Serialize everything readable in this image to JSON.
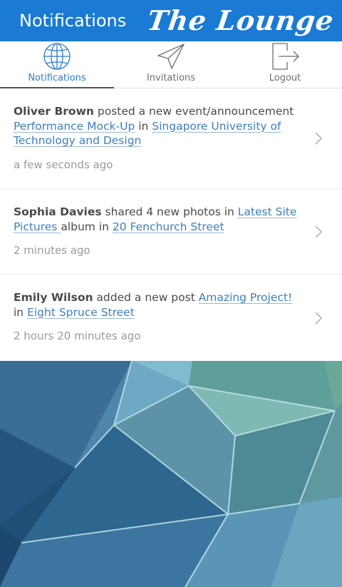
{
  "header": {
    "title": "Notifications",
    "brand": "The Lounge",
    "color": "#1a7ad4"
  },
  "tabs": [
    {
      "label": "Notifications",
      "icon": "globe-icon",
      "active": true
    },
    {
      "label": "Invitations",
      "icon": "paper-plane-icon",
      "active": false
    },
    {
      "label": "Logout",
      "icon": "logout-icon",
      "active": false
    }
  ],
  "notifications": [
    {
      "actor": "Oliver Brown",
      "action": " posted a new event/announcement ",
      "link1": "Performance Mock-Up",
      "joiner": " in ",
      "link2": "Singapore University of Technology and Design",
      "tail": "",
      "time": "a few seconds ago"
    },
    {
      "actor": "Sophia Davies",
      "action": " shared 4 new photos in ",
      "link1": "Latest Site Pictures ",
      "joiner": "album in ",
      "link2": "20 Fenchurch Street",
      "tail": "",
      "time": "2 minutes ago"
    },
    {
      "actor": "Emily Wilson",
      "action": " added a new post ",
      "link1": "Amazing Project!",
      "joiner": " in ",
      "link2": "Eight Spruce Street",
      "tail": "",
      "time": "2 hours 20 minutes ago"
    }
  ],
  "colors": {
    "link": "#3d7fbe",
    "active_tab": "#2a7cc9",
    "muted": "#9a9a9a"
  }
}
